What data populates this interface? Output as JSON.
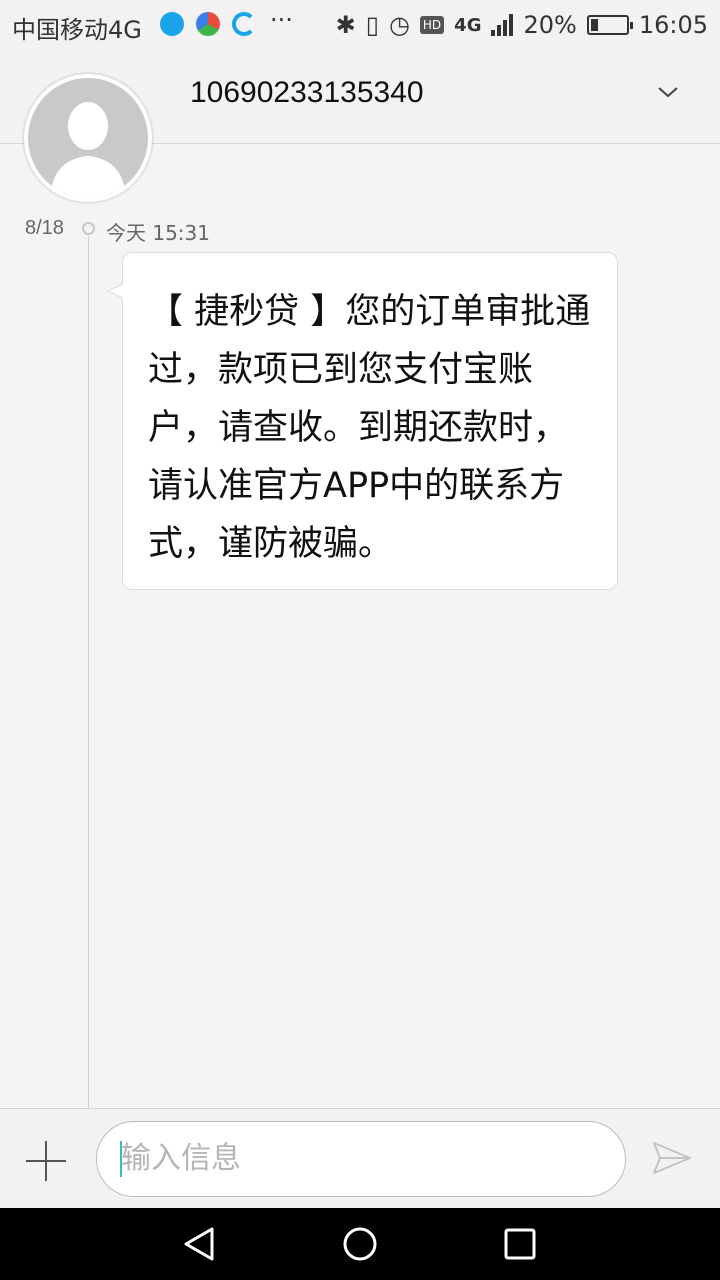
{
  "status_bar": {
    "carrier": "中国移动4G",
    "more": "···",
    "network": "4G",
    "battery_percent": "20%",
    "battery_level": 0.2,
    "time": "16:05"
  },
  "header": {
    "contact_number": "10690233135340"
  },
  "thread": {
    "date": "8/18",
    "time": "今天 15:31",
    "message": "【 捷秒贷 】您的订单审批通过，款项已到您支付宝账户，请查收。到期还款时，请认准官方APP中的联系方式，谨防被骗。"
  },
  "composer": {
    "placeholder": "输入信息"
  },
  "colors": {
    "accent_caret": "#3fb6c9",
    "background": "#f4f4f4"
  }
}
